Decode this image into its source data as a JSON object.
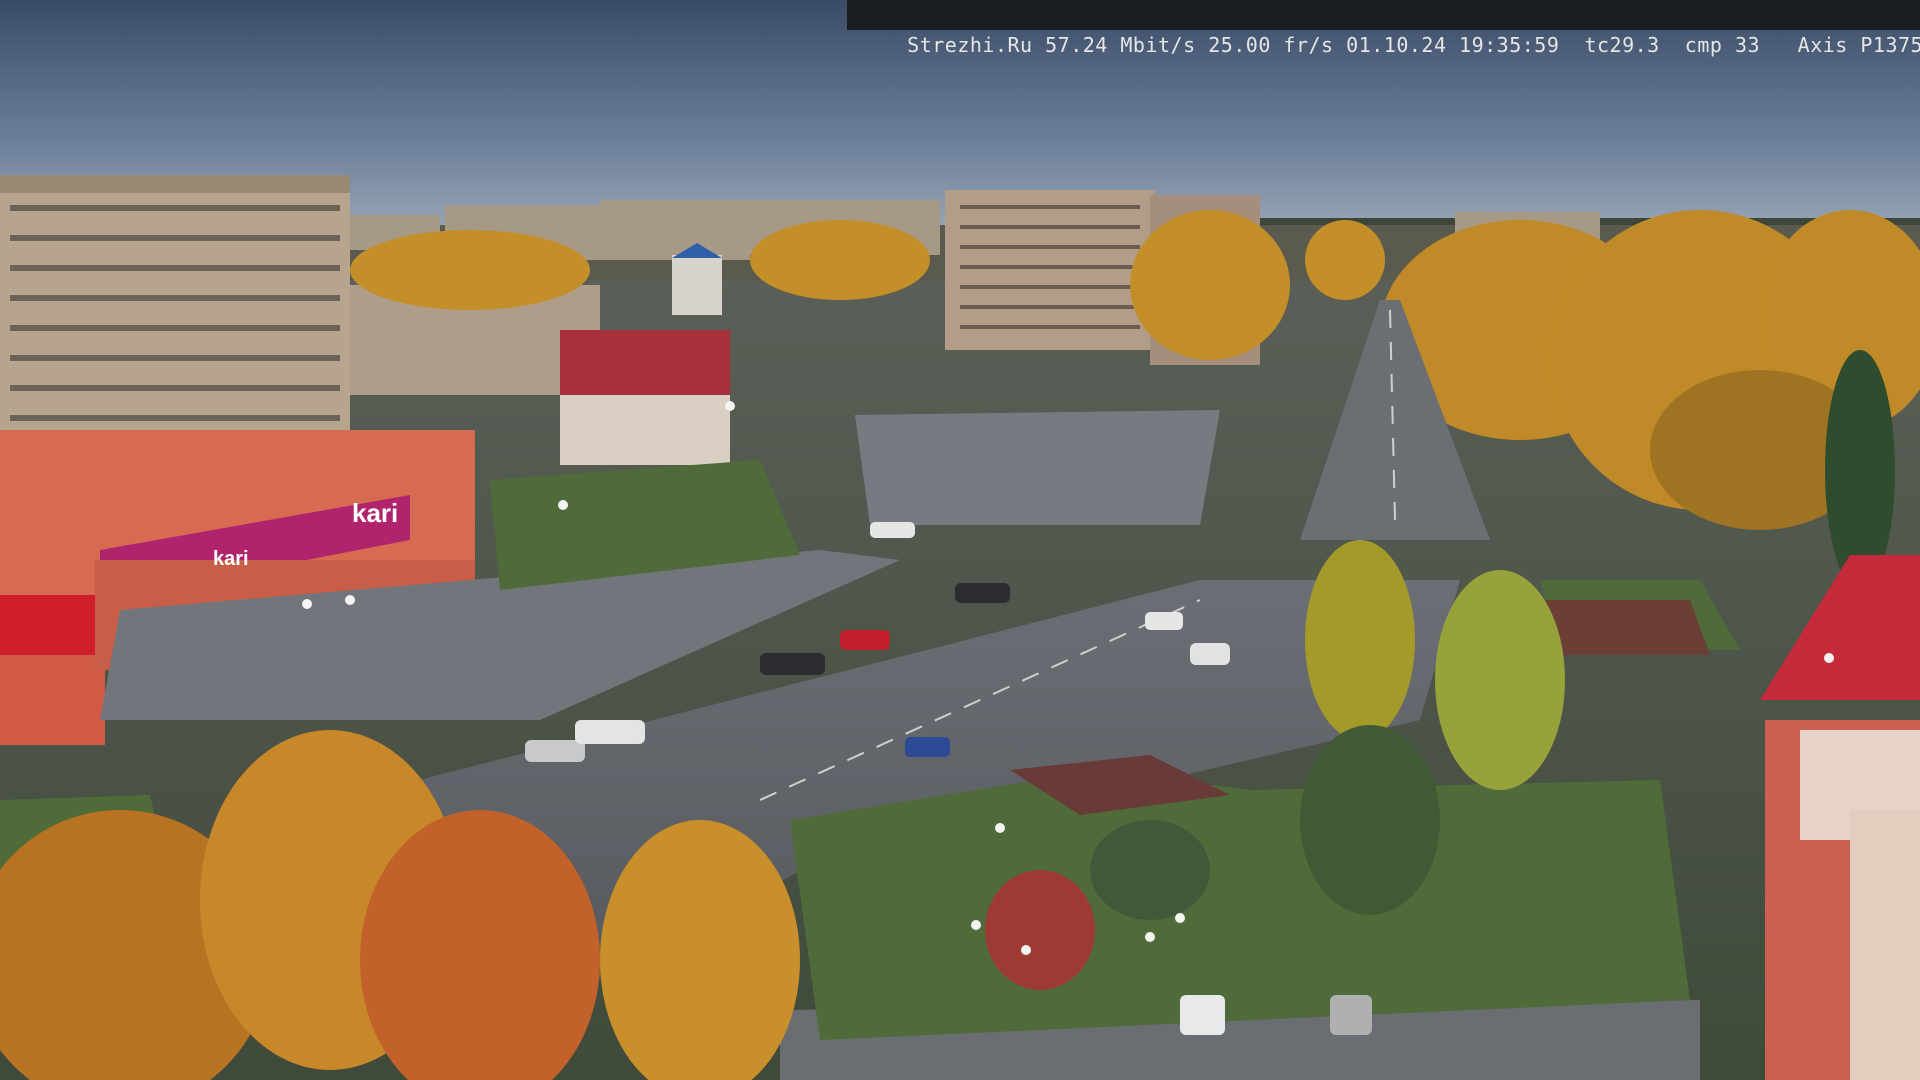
{
  "overlay": {
    "site": "Strezhi.Ru",
    "bitrate": "57.24 Mbit/s",
    "framerate": "25.00 fr/s",
    "date": "01.10.24",
    "time": "19:35:59",
    "tc": "tc29.3",
    "cmp": "cmp 33",
    "camera": "Axis P1375"
  },
  "signs": {
    "store_main": "kari",
    "store_banner_text": "kari",
    "store_small": "kari"
  },
  "colors": {
    "sky_top": "#3d4e6a",
    "sky_bottom": "#8fa0b8",
    "foliage": "#c8902a",
    "store_pink": "#b0246e"
  }
}
